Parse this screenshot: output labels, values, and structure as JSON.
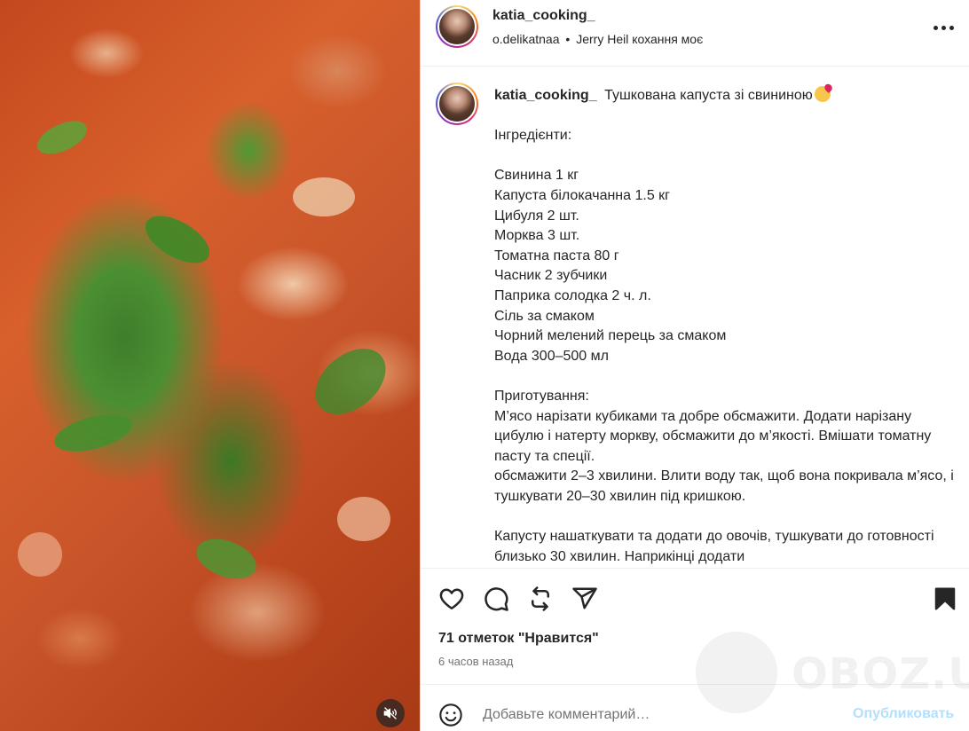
{
  "header": {
    "username": "katia_cooking_",
    "audio_source": "o.delikatnaa",
    "separator": "•",
    "audio_title": "Jerry Heil кохання моє"
  },
  "caption": {
    "username": "katia_cooking_",
    "title": "Тушкована капуста зі свининою",
    "lines": [
      "",
      "Інгредієнти:",
      "",
      "Свинина 1 кг",
      "Капуста білокачанна 1.5 кг",
      "Цибуля 2 шт.",
      "Морква 3 шт.",
      "Томатна паста 80 г",
      "Часник 2 зубчики",
      "Паприка солодка 2 ч. л.",
      "Сіль за смаком",
      "Чорний мелений перець за смаком",
      "Вода 300–500 мл",
      "",
      "Приготування:",
      "М’ясо нарізати кубиками та добре обсмажити. Додати нарізану цибулю і натерту моркву, обсмажити до м’якості. Вмішати томатну пасту та спеції.",
      "обсмажити 2–3 хвилини. Влити воду так, щоб вона покривала м’ясо, і тушкувати 20–30 хвилин під кришкою.",
      "",
      "Капусту нашаткувати та додати до овочів, тушкувати до готовності близько 30 хвилин. Наприкінці додати"
    ]
  },
  "actions": {
    "like_icon": "heart-icon",
    "comment_icon": "comment-icon",
    "repost_icon": "repost-icon",
    "share_icon": "share-icon",
    "save_icon": "bookmark-icon"
  },
  "likes_text": "71 отметок \"Нравится\"",
  "time_text": "6 часов назад",
  "comment": {
    "placeholder": "Добавьте комментарий…",
    "post_label": "Опубликовать"
  },
  "watermark": {
    "text": "OBOZ.UA"
  },
  "colors": {
    "post_button": "#b2dffc",
    "muted_text": "#737373",
    "text": "#262626"
  }
}
